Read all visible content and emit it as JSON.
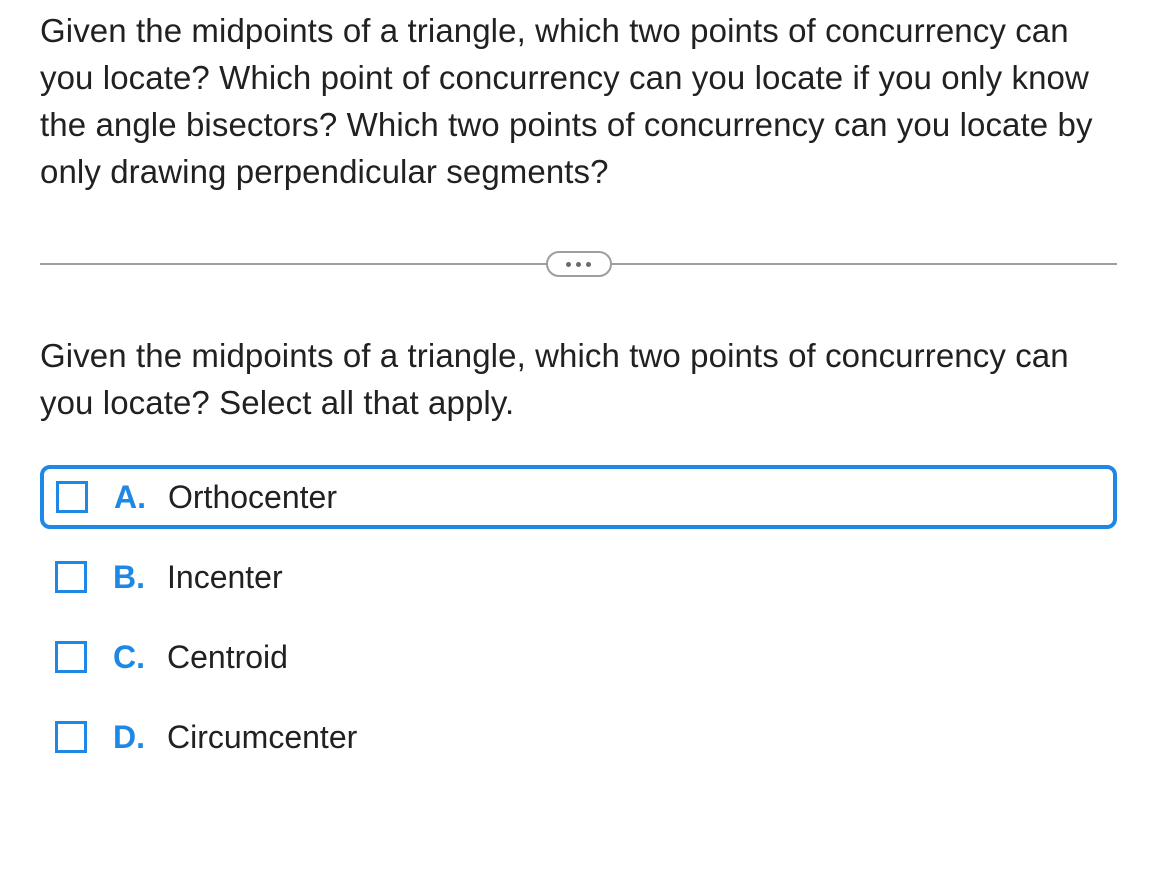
{
  "intro_text": "Given the midpoints of a triangle, which two points of concurrency can you locate? Which point of concurrency can you locate if you only know the angle bisectors? Which two points of concurrency can you locate by only drawing perpendicular segments?",
  "sub_question_text": "Given the midpoints of a triangle, which two points of concurrency can you locate? Select all that apply.",
  "options": [
    {
      "letter": "A.",
      "text": "Orthocenter",
      "highlighted": true
    },
    {
      "letter": "B.",
      "text": "Incenter",
      "highlighted": false
    },
    {
      "letter": "C.",
      "text": "Centroid",
      "highlighted": false
    },
    {
      "letter": "D.",
      "text": "Circumcenter",
      "highlighted": false
    }
  ]
}
